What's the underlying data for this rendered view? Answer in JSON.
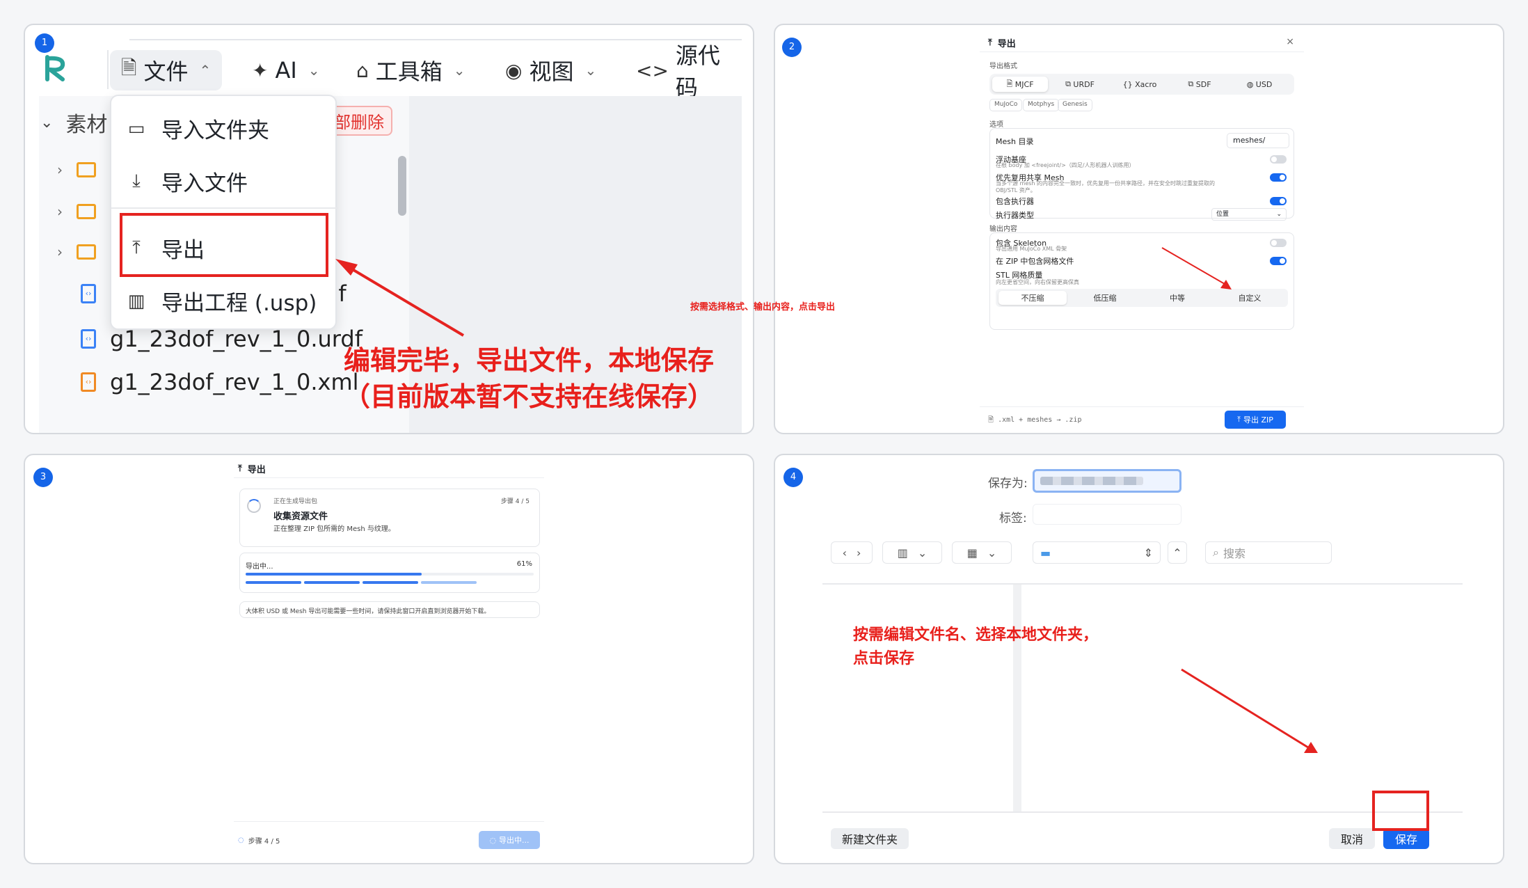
{
  "panel1": {
    "num": "1",
    "toolbar": [
      {
        "icon": "file-doc-icon",
        "label": "文件",
        "glyph": "🗎",
        "chev": "⌃"
      },
      {
        "icon": "ai-sparkle-icon",
        "label": "AI",
        "glyph": "✦",
        "chev": "⌄"
      },
      {
        "icon": "toolbox-icon",
        "label": "工具箱",
        "glyph": "⌂",
        "chev": "⌄"
      },
      {
        "icon": "eye-icon",
        "label": "视图",
        "glyph": "◉",
        "chev": "⌄"
      },
      {
        "icon": "code-icon",
        "label": "源代码",
        "glyph": "<>"
      }
    ],
    "tree_head": "素材",
    "delete_tag": "部删除",
    "files": [
      "df",
      "g1_23dof_rev_1_0.urdf",
      "g1_23dof_rev_1_0.xml"
    ],
    "menu": [
      {
        "icon": "folder-icon",
        "label": "导入文件夹",
        "glyph": "▭"
      },
      {
        "icon": "download-icon",
        "label": "导入文件",
        "glyph": "⤓"
      },
      {
        "icon": "upload-icon",
        "label": "导出",
        "glyph": "⤒"
      },
      {
        "icon": "package-icon",
        "label": "导出工程 (.usp)",
        "glyph": "▥"
      }
    ],
    "caption_line1": "编辑完毕，导出文件，本地保存",
    "caption_line2": "（目前版本暂不支持在线保存）"
  },
  "panel2": {
    "num": "2",
    "title": "导出",
    "close": "×",
    "format_label": "导出格式",
    "formats": [
      "MJCF",
      "URDF",
      "Xacro",
      "SDF",
      "USD"
    ],
    "engines": [
      "MuJoCo",
      "Motphys",
      "Genesis"
    ],
    "options_label": "选项",
    "mesh_dir_label": "Mesh 目录",
    "mesh_dir_value": "meshes/",
    "floating_base": "浮动基座",
    "floating_base_sub": "在根 body 加 <freejoint/>（四足/人形机器人训练用）",
    "share_mesh": "优先复用共享 Mesh",
    "share_mesh_sub": "当多个源 mesh 的内容完全一致时，优先复用一份共享路径，并在安全时跳过重复提取的 OBJ/STL 资产。",
    "include_actuator": "包含执行器",
    "actuator_type": "执行器类型",
    "actuator_value": "位置",
    "output_label": "输出内容",
    "include_skeleton": "包含 Skeleton",
    "skeleton_sub": "导出通用 MuJoCo XML 骨架",
    "zip_mesh": "在 ZIP 中包含网格文件",
    "stl_quality": "STL 网格质量",
    "stl_sub": "向左更省空间，向右保留更高保真",
    "qualities": [
      "不压缩",
      "低压缩",
      "中等",
      "自定义"
    ],
    "footer": ".xml + meshes → .zip",
    "export_button": "导出 ZIP",
    "caption": "按需选择格式、输出内容，点击导出",
    "toggles": {
      "floating_base": false,
      "share_mesh": true,
      "include_actuator": true,
      "include_skeleton": false,
      "zip_mesh": true
    }
  },
  "panel3": {
    "num": "3",
    "title": "导出",
    "stage_small": "正在生成导出包",
    "step_badge": "步骤 4 / 5",
    "stage_title": "收集资源文件",
    "stage_desc": "正在整理 ZIP 包所需的 Mesh 与纹理。",
    "progress_label": "导出中...",
    "progress_percent": "61%",
    "progress": 0.61,
    "note": "大体积 USD 或 Mesh 导出可能需要一些时间，请保持此窗口开启直到浏览器开始下载。",
    "footer_step": "步骤 4 / 5",
    "button": "导出中..."
  },
  "panel4": {
    "num": "4",
    "save_as_label": "保存为:",
    "tags_label": "标签:",
    "search_placeholder": "搜索",
    "new_folder": "新建文件夹",
    "cancel": "取消",
    "save": "保存",
    "caption_line1": "按需编辑文件名、选择本地文件夹，",
    "caption_line2": "点击保存"
  },
  "colors": {
    "accent": "#1668f0",
    "annotation": "#e52320",
    "folder": "#f0a020"
  }
}
